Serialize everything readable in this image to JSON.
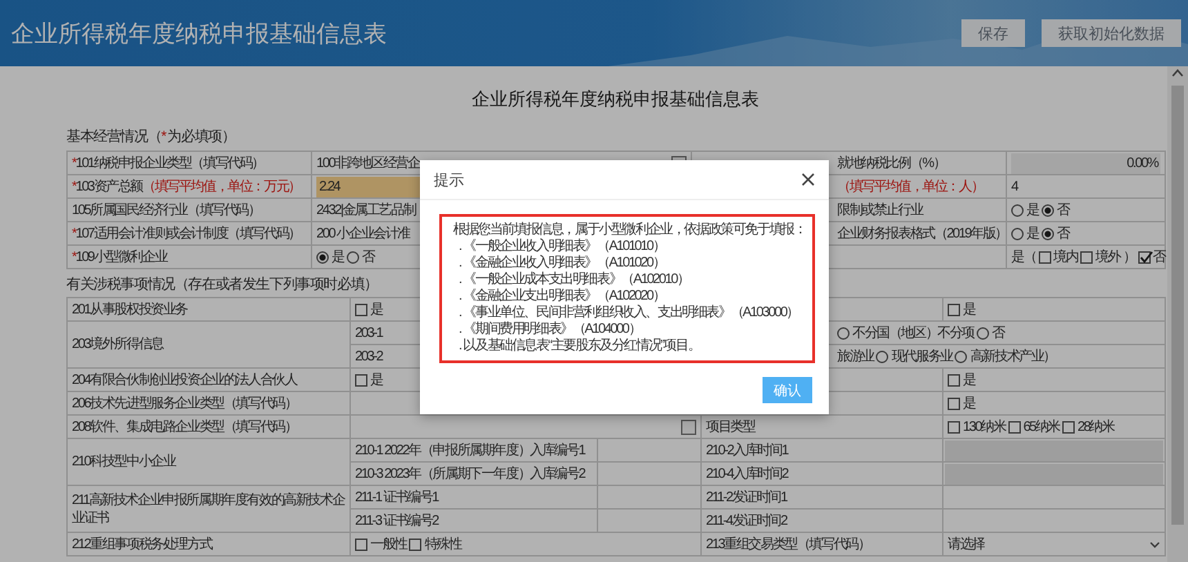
{
  "header": {
    "title": "企业所得税年度纳税申报基础信息表",
    "buttons": [
      {
        "label": "保存"
      },
      {
        "label": "获取初始化数据"
      }
    ]
  },
  "form": {
    "title": "企业所得税年度纳税申报基础信息表",
    "basic_section": {
      "heading": [
        {
          "text": "基本经营情况（",
          "kind": "plain"
        },
        {
          "text": "*",
          "kind": "required"
        },
        {
          "text": " 为必填项）",
          "kind": "plain"
        }
      ],
      "rows": [
        {
          "cells": [
            {
              "kind": "label",
              "required": true,
              "text": "101纳税申报企业类型（填写代码）"
            },
            {
              "kind": "value",
              "items": [
                {
                  "kind": "text",
                  "text": "100非跨地区经营企"
                },
                {
                  "kind": "picker"
                }
              ]
            },
            {
              "kind": "label",
              "required": false,
              "text": "就地纳税比例（%）"
            },
            {
              "kind": "value",
              "items": [
                {
                  "kind": "amount",
                  "text": "0.00%"
                }
              ]
            }
          ]
        },
        {
          "cells": [
            {
              "kind": "label",
              "required": true,
              "text": "103资产总额",
              "note": "（填写平均值，单位：万元）"
            },
            {
              "kind": "value",
              "items": [
                {
                  "kind": "input",
                  "text": "2.24",
                  "highlighted": true
                }
              ]
            },
            {
              "kind": "label",
              "required": false,
              "note": "（填写平均值，单位：人）"
            },
            {
              "kind": "value",
              "items": [
                {
                  "kind": "text",
                  "text": "4"
                }
              ]
            }
          ]
        },
        {
          "cells": [
            {
              "kind": "label",
              "required": false,
              "text": "105所属国民经济行业（填写代码）"
            },
            {
              "kind": "value",
              "items": [
                {
                  "kind": "text",
                  "text": "2432|金属工艺品制"
                }
              ]
            },
            {
              "kind": "label",
              "required": false,
              "text": "限制或禁止行业"
            },
            {
              "kind": "value",
              "items": [
                {
                  "kind": "radio",
                  "label": "是",
                  "selected": false
                },
                {
                  "kind": "radio",
                  "label": "否",
                  "selected": true
                }
              ]
            }
          ]
        },
        {
          "cells": [
            {
              "kind": "label",
              "required": true,
              "text": "107适用会计准则或会计制度（填写代码）"
            },
            {
              "kind": "value",
              "items": [
                {
                  "kind": "text",
                  "text": "200 小企业会计准"
                }
              ]
            },
            {
              "kind": "label",
              "required": false,
              "text": "企业财务报表格式（2019年版）"
            },
            {
              "kind": "value",
              "items": [
                {
                  "kind": "radio",
                  "label": "是",
                  "selected": false
                },
                {
                  "kind": "radio",
                  "label": "否",
                  "selected": true
                }
              ]
            }
          ]
        },
        {
          "cells": [
            {
              "kind": "label",
              "required": true,
              "text": "109小型微利企业"
            },
            {
              "kind": "value",
              "items": [
                {
                  "kind": "radio",
                  "label": "是",
                  "selected": true
                },
                {
                  "kind": "radio",
                  "label": "否",
                  "selected": false
                }
              ]
            },
            {
              "kind": "empty"
            },
            {
              "kind": "value",
              "items": [
                {
                  "kind": "text",
                  "text": "是（"
                },
                {
                  "kind": "check",
                  "label": "境内",
                  "checked": false
                },
                {
                  "kind": "check",
                  "label": "境外",
                  "checked": false
                },
                {
                  "kind": "text",
                  "text": "）"
                },
                {
                  "kind": "check",
                  "label": "否",
                  "checked": true
                }
              ]
            }
          ]
        }
      ]
    },
    "tax_section": {
      "heading": [
        {
          "text": "有关涉税事项情况（存在或者发生下列事项时必填）",
          "kind": "plain"
        }
      ],
      "groups": [
        {
          "label": "201从事股权投资业务",
          "lines": [
            {
              "cells": [
                {
                  "kind": "value",
                  "items": [
                    {
                      "kind": "check",
                      "label": "是",
                      "checked": false
                    }
                  ]
                },
                {
                  "kind": "empty"
                },
                {
                  "kind": "value",
                  "items": [
                    {
                      "kind": "check",
                      "label": "是",
                      "checked": false
                    }
                  ]
                }
              ]
            }
          ]
        },
        {
          "label": "203境外所得信息",
          "lines": [
            {
              "cells": [
                {
                  "kind": "label",
                  "text": "203-1"
                },
                {
                  "kind": "empty"
                },
                {
                  "kind": "value",
                  "items": [
                    {
                      "kind": "radio",
                      "label": "不分国（地区）不分项",
                      "selected": false
                    },
                    {
                      "kind": "radio",
                      "label": "否",
                      "selected": false
                    }
                  ]
                }
              ]
            },
            {
              "cells": [
                {
                  "kind": "label",
                  "text": "203-2"
                },
                {
                  "kind": "empty"
                },
                {
                  "kind": "value",
                  "items": [
                    {
                      "kind": "text",
                      "text": "旅游业"
                    },
                    {
                      "kind": "radio",
                      "label": "现代服务业",
                      "selected": false
                    },
                    {
                      "kind": "radio",
                      "label": "高新技术产业）",
                      "selected": false
                    }
                  ]
                }
              ]
            }
          ]
        },
        {
          "label": "204有限合伙制创业投资企业的法人合伙人",
          "lines": [
            {
              "cells": [
                {
                  "kind": "value",
                  "items": [
                    {
                      "kind": "check",
                      "label": "是",
                      "checked": false
                    }
                  ]
                },
                {
                  "kind": "empty"
                },
                {
                  "kind": "value",
                  "items": [
                    {
                      "kind": "check",
                      "label": "是",
                      "checked": false
                    }
                  ]
                }
              ]
            }
          ]
        },
        {
          "label": "206技术先进型服务企业类型（填写代码）",
          "lines": [
            {
              "cells": [
                {
                  "kind": "empty"
                },
                {
                  "kind": "empty"
                },
                {
                  "kind": "value",
                  "items": [
                    {
                      "kind": "check",
                      "label": "是",
                      "checked": false
                    }
                  ]
                }
              ]
            }
          ]
        },
        {
          "label": "208软件、集成电路企业类型（填写代码）",
          "lines": [
            {
              "cells": [
                {
                  "kind": "value",
                  "items": [
                    {
                      "kind": "picker"
                    }
                  ]
                },
                {
                  "kind": "label",
                  "text": "项目类型"
                },
                {
                  "kind": "value",
                  "items": [
                    {
                      "kind": "check",
                      "label": "130纳米",
                      "checked": false
                    },
                    {
                      "kind": "check",
                      "label": "65纳米",
                      "checked": false
                    },
                    {
                      "kind": "check",
                      "label": "28纳米",
                      "checked": false
                    }
                  ]
                }
              ]
            }
          ]
        },
        {
          "label": "210科技型中小企业",
          "lines": [
            {
              "cells": [
                {
                  "kind": "label",
                  "text": "210-1  2022年（申报所属期年度）入库编号1"
                },
                {
                  "kind": "empty"
                },
                {
                  "kind": "label",
                  "text": "210-2入库时间1"
                },
                {
                  "kind": "field",
                  "disabled": true
                }
              ]
            },
            {
              "cells": [
                {
                  "kind": "label",
                  "text": "210-3  2023年（所属期下一年度）入库编号2"
                },
                {
                  "kind": "empty"
                },
                {
                  "kind": "label",
                  "text": "210-4入库时间2"
                },
                {
                  "kind": "field",
                  "disabled": true
                }
              ]
            }
          ]
        },
        {
          "label": "211高新技术企业申报所属期年度有效的高新技术企业证书",
          "lines": [
            {
              "cells": [
                {
                  "kind": "label",
                  "text": "211-1 证书编号1"
                },
                {
                  "kind": "empty"
                },
                {
                  "kind": "label",
                  "text": "211-2发证时间1"
                },
                {
                  "kind": "empty"
                }
              ]
            },
            {
              "cells": [
                {
                  "kind": "label",
                  "text": "211-3 证书编号2"
                },
                {
                  "kind": "empty"
                },
                {
                  "kind": "label",
                  "text": "211-4发证时间2"
                },
                {
                  "kind": "empty"
                }
              ]
            }
          ]
        },
        {
          "label": "212重组事项税务处理方式",
          "lines": [
            {
              "cells": [
                {
                  "kind": "value",
                  "items": [
                    {
                      "kind": "check",
                      "label": "一般性",
                      "checked": false
                    },
                    {
                      "kind": "check",
                      "label": "特殊性",
                      "checked": false
                    }
                  ]
                },
                {
                  "kind": "label",
                  "text": "213重组交易类型（填写代码）"
                },
                {
                  "kind": "value",
                  "items": [
                    {
                      "kind": "select",
                      "text": "请选择"
                    }
                  ]
                }
              ]
            }
          ]
        }
      ]
    }
  },
  "dialog": {
    "title": "提示",
    "intro": "根据您当前填报信息，属于小型微利企业，依据政策可免于填报：",
    "items": [
      ". 《一般企业收入明细表》（A101010）",
      ". 《金融企业收入明细表》（A101020）",
      ". 《一般企业成本支出明细表》（A102010）",
      ". 《金融企业支出明细表》（A102020）",
      ". 《事业单位、民间非营利组织收入、支出明细表》（A103000）",
      ". 《期间费用明细表》（A104000）",
      ". 以及基础信息表“主要股东及分红情况”项目。"
    ],
    "button": "确认"
  }
}
